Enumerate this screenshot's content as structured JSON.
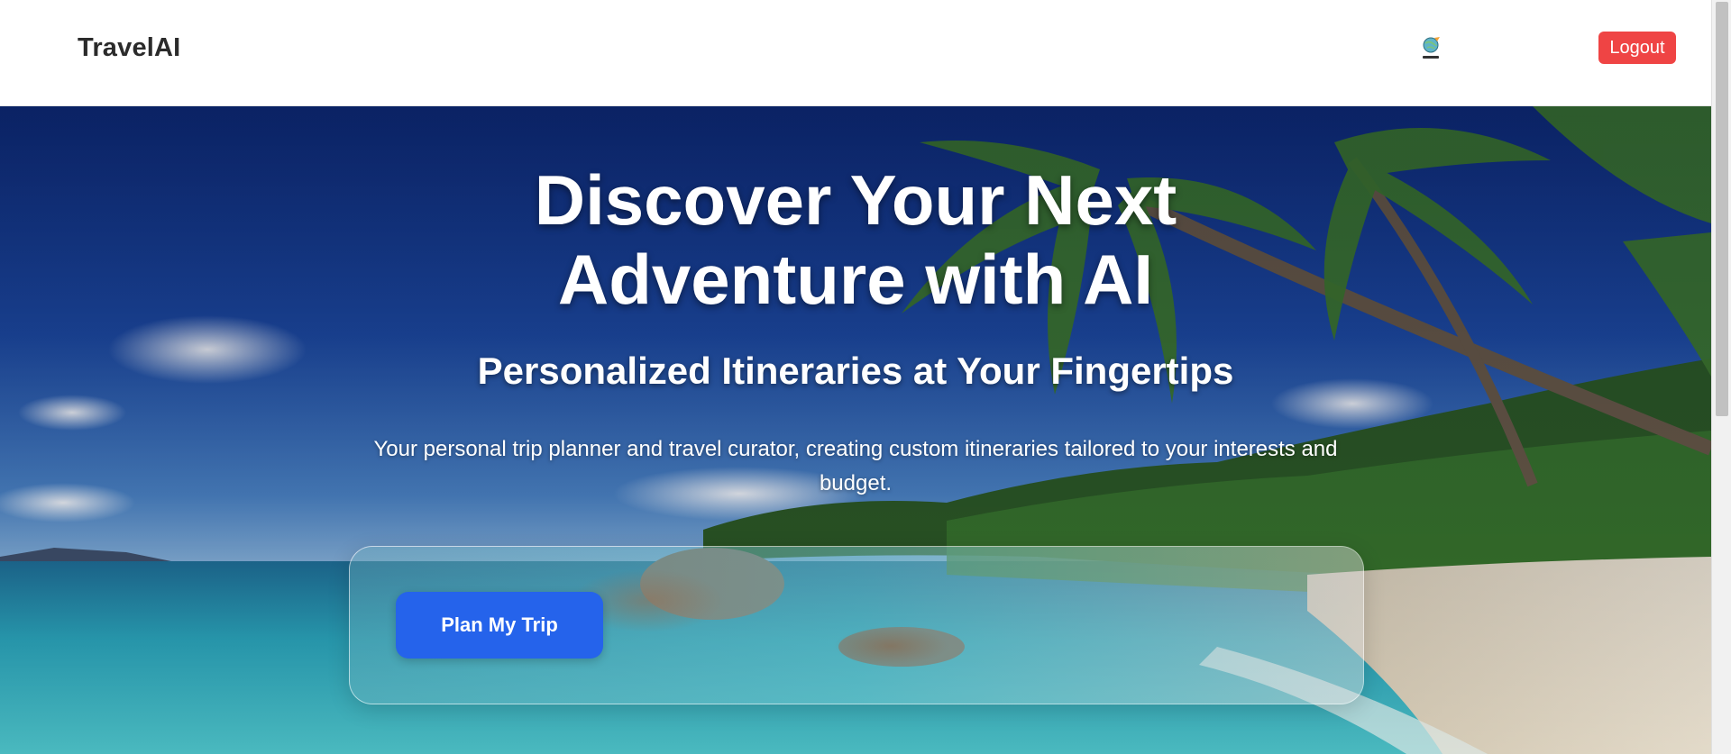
{
  "navbar": {
    "brand": "TravelAI",
    "logo_icon": "travel-globe-logo",
    "logout_label": "Logout"
  },
  "hero": {
    "title": "Discover Your Next Adventure with AI",
    "subtitle": "Personalized Itineraries at Your Fingertips",
    "description": "Your personal trip planner and travel curator, creating custom itineraries tailored to your interests and budget.",
    "cta_label": "Plan My Trip",
    "background": "tropical-beach-with-palm-trees"
  },
  "colors": {
    "logout": "#ef4444",
    "cta": "#2563eb",
    "brand_text": "#2b2b2b"
  }
}
